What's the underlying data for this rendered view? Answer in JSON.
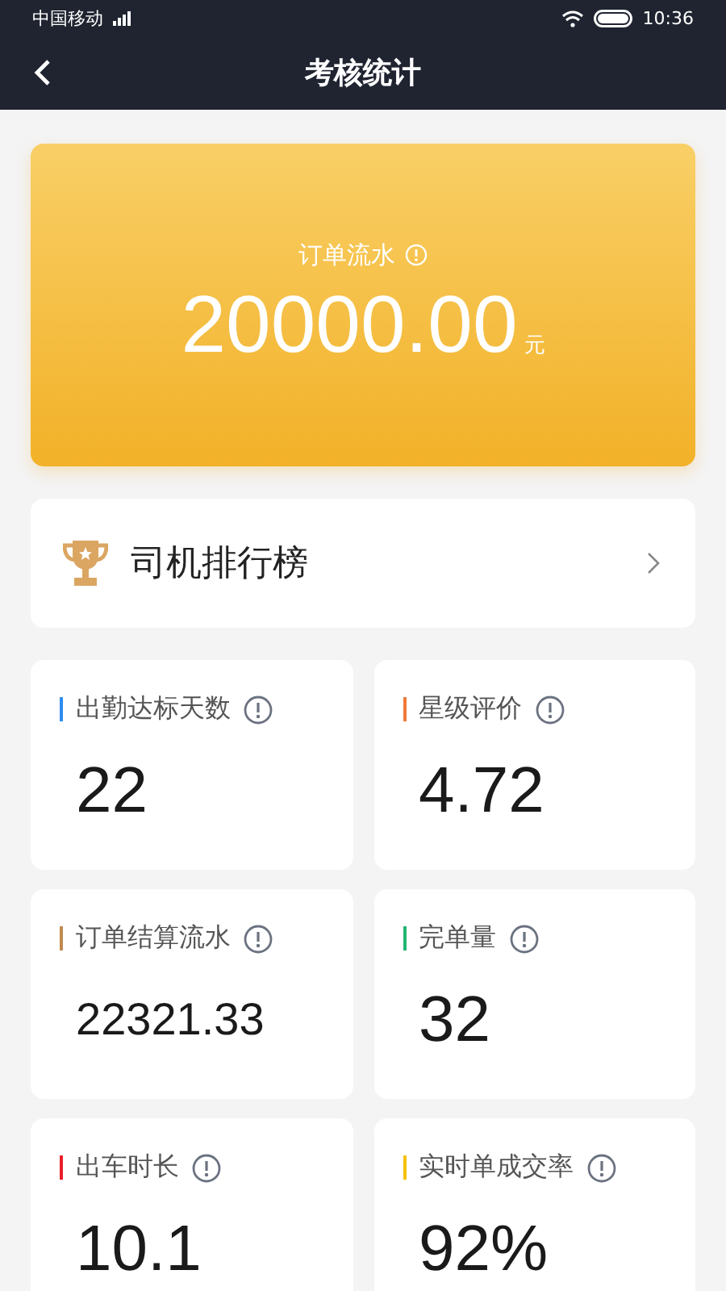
{
  "status_bar": {
    "carrier": "中国移动",
    "time": "10:36"
  },
  "nav": {
    "title": "考核统计"
  },
  "revenue": {
    "label": "订单流水",
    "amount": "20000.00",
    "unit": "元"
  },
  "ranking": {
    "label": "司机排行榜"
  },
  "stats": [
    {
      "label": "出勤达标天数",
      "value": "22",
      "color": "#2f8cf0"
    },
    {
      "label": "星级评价",
      "value": "4.72",
      "color": "#f07a3a"
    },
    {
      "label": "订单结算流水",
      "value": "22321.33",
      "color": "#c08a50"
    },
    {
      "label": "完单量",
      "value": "32",
      "color": "#22b573"
    },
    {
      "label": "出车时长",
      "value": "10.1",
      "color": "#e8202a"
    },
    {
      "label": "实时单成交率",
      "value": "92%",
      "color": "#f5c000"
    }
  ]
}
